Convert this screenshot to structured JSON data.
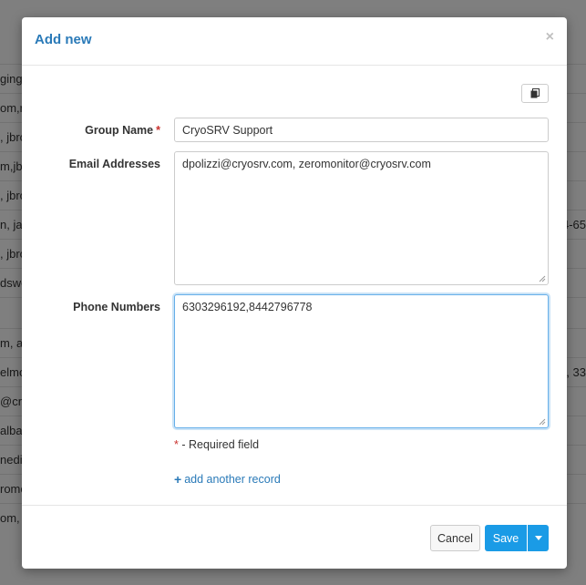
{
  "background": {
    "rows": [
      {
        "left": "ging.c",
        "right": ""
      },
      {
        "left": "om,r",
        "right": ""
      },
      {
        "left": ", jbro",
        "right": ""
      },
      {
        "left": "m,jbro",
        "right": ""
      },
      {
        "left": ", jbro",
        "right": ""
      },
      {
        "left": "n, jan",
        "right": "4-65"
      },
      {
        "left": ", jbro",
        "right": ""
      },
      {
        "left": "dswe",
        "right": ""
      },
      {
        "left": "",
        "right": ""
      },
      {
        "left": "m, aa",
        "right": ""
      },
      {
        "left": "elmor",
        "right": "5, 33"
      },
      {
        "left": "@cryo",
        "right": ""
      },
      {
        "left": "alba",
        "right": ""
      },
      {
        "left": "nedin",
        "right": ""
      },
      {
        "left": "romo",
        "right": ""
      },
      {
        "left": "om, r",
        "right": ""
      }
    ]
  },
  "modal": {
    "title": "Add new",
    "close_glyph": "×",
    "copy_icon": "clipboard-icon",
    "fields": {
      "group_name": {
        "label": "Group Name",
        "required_mark": "*",
        "value": "CryoSRV Support"
      },
      "email_addresses": {
        "label": "Email Addresses",
        "value": "dpolizzi@cryosrv.com, zeromonitor@cryosrv.com"
      },
      "phone_numbers": {
        "label": "Phone Numbers",
        "value": "6303296192,8442796778"
      }
    },
    "required_note": {
      "mark": "*",
      "text": " - Required field"
    },
    "add_another": {
      "icon": "plus-icon",
      "text": "add another record"
    },
    "footer": {
      "cancel_label": "Cancel",
      "save_label": "Save"
    }
  },
  "colors": {
    "accent": "#2a7ab8",
    "primary_button": "#1a9be6",
    "required": "#c9302c"
  }
}
